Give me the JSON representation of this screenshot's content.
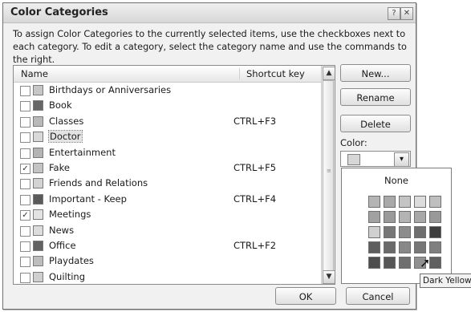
{
  "dialog": {
    "title": "Color Categories",
    "help_glyph": "?",
    "close_glyph": "✕",
    "description": "To assign Color Categories to the currently selected items, use the checkboxes next to each category.  To edit a category, select the category name and use the commands to the right."
  },
  "list": {
    "headers": {
      "name": "Name",
      "shortcut": "Shortcut key"
    },
    "scroll_up_glyph": "▲",
    "scroll_down_glyph": "▼",
    "items": [
      {
        "name": "Birthdays or Anniversaries",
        "shortcut": "",
        "checked": false,
        "color": "#c6c6c6"
      },
      {
        "name": "Book",
        "shortcut": "",
        "checked": false,
        "color": "#666666"
      },
      {
        "name": "Classes",
        "shortcut": "CTRL+F3",
        "checked": false,
        "color": "#b9b9b9"
      },
      {
        "name": "Doctor",
        "shortcut": "",
        "checked": false,
        "color": "#d9d9d9"
      },
      {
        "name": "Entertainment",
        "shortcut": "",
        "checked": false,
        "color": "#b3b3b3"
      },
      {
        "name": "Fake",
        "shortcut": "CTRL+F5",
        "checked": true,
        "color": "#c4c4c4"
      },
      {
        "name": "Friends and Relations",
        "shortcut": "",
        "checked": false,
        "color": "#d3d3d3"
      },
      {
        "name": "Important - Keep",
        "shortcut": "CTRL+F4",
        "checked": false,
        "color": "#5a5a5a"
      },
      {
        "name": "Meetings",
        "shortcut": "",
        "checked": true,
        "color": "#e3e3e3"
      },
      {
        "name": "News",
        "shortcut": "",
        "checked": false,
        "color": "#dcdcdc"
      },
      {
        "name": "Office",
        "shortcut": "CTRL+F2",
        "checked": false,
        "color": "#616161"
      },
      {
        "name": "Playdates",
        "shortcut": "",
        "checked": false,
        "color": "#bdbdbd"
      },
      {
        "name": "Quilting",
        "shortcut": "",
        "checked": false,
        "color": "#cfcfcf"
      }
    ],
    "check_glyph": "✓"
  },
  "buttons": {
    "new": "New...",
    "rename": "Rename",
    "delete": "Delete",
    "ok": "OK",
    "cancel": "Cancel"
  },
  "color_picker": {
    "label": "Color:",
    "dropdown_glyph": "▾",
    "none_label": "None",
    "tooltip": "Dark Yellow",
    "swatches": [
      [
        "#b5b5b5",
        "#a9a9a9",
        "#c4c4c4",
        "#dcdcdc",
        "#bfbfbf"
      ],
      [
        "#a1a1a1",
        "#9a9a9a",
        "#b3b3b3",
        "#a8a8a8",
        "#999999"
      ],
      [
        "#d0d0d0",
        "#777777",
        "#8c8c8c",
        "#6e6e6e",
        "#3e3e3e"
      ],
      [
        "#5e5e5e",
        "#6a6a6a",
        "#888888",
        "#777777",
        "#7f7f7f"
      ],
      [
        "#4d4d4d",
        "#575757",
        "#6f6f6f",
        "#909090",
        "#5f5f5f"
      ]
    ]
  }
}
